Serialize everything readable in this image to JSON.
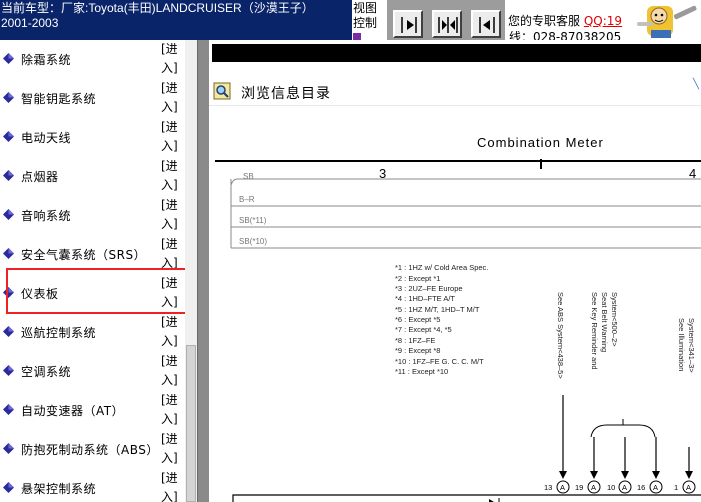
{
  "header": {
    "vehicle_line1": "当前车型：厂家:Toyota(丰田)LANDCRUISER（沙漠王子）",
    "vehicle_line2": "2001-2003",
    "view_control_line1": "视图",
    "view_control_line2": "控制",
    "service_label": "您的专职客服",
    "qq_label": "QQ:19",
    "phone_partial": "线：028-87038205",
    "nav_buttons": [
      "next-page-icon",
      "fit-width-icon",
      "previous-page-icon"
    ]
  },
  "sidebar": {
    "enter_line1": "[进",
    "enter_line2": "入]",
    "items": [
      {
        "label": "除霜系统"
      },
      {
        "label": "智能钥匙系统"
      },
      {
        "label": "电动天线"
      },
      {
        "label": "点烟器"
      },
      {
        "label": "音响系统"
      },
      {
        "label": "安全气囊系统（SRS）"
      },
      {
        "label": "仪表板",
        "highlighted": true
      },
      {
        "label": "巡航控制系统"
      },
      {
        "label": "空调系统"
      },
      {
        "label": "自动变速器（AT）"
      },
      {
        "label": "防抱死制动系统（ABS）"
      },
      {
        "label": "悬架控制系统"
      }
    ],
    "colors": {
      "diamond": "#2a2a9a",
      "highlight_border": "#e22222"
    }
  },
  "main": {
    "browse_title": "浏览信息目录",
    "browse_icon": "magnifier-document-icon",
    "diagram": {
      "title": "Combination Meter",
      "column_numbers": [
        "3",
        "4"
      ],
      "bus_lines": [
        "SB",
        "B–R",
        "SB(*11)",
        "SB(*10)"
      ],
      "notes": [
        "*1 : 1HZ w/ Cold Area Spec.",
        "*2 : Except *1",
        "*3 : 2UZ–FE Europe",
        "*4 : 1HD–FTE A/T",
        "*5 : 1HZ M/T, 1HD–T M/T",
        "*6 : Except *5",
        "*7 : Except *4, *5",
        "*8 : 1FZ–FE",
        "*9 : Except *8",
        "*10 : 1FZ–FE G. C. C.  M/T",
        "*11 : Except *10"
      ],
      "references": [
        "See ABS System<438–5>",
        "See Key Reminder and",
        "Seat Belt Warning",
        "System<500–2>",
        "See Illumination",
        "System<341–3>"
      ],
      "pins": [
        {
          "number": "13",
          "connector": "A"
        },
        {
          "number": "19",
          "connector": "A"
        },
        {
          "number": "10",
          "connector": "A"
        },
        {
          "number": "16",
          "connector": "A"
        },
        {
          "number": "1",
          "connector": "A"
        }
      ]
    }
  }
}
